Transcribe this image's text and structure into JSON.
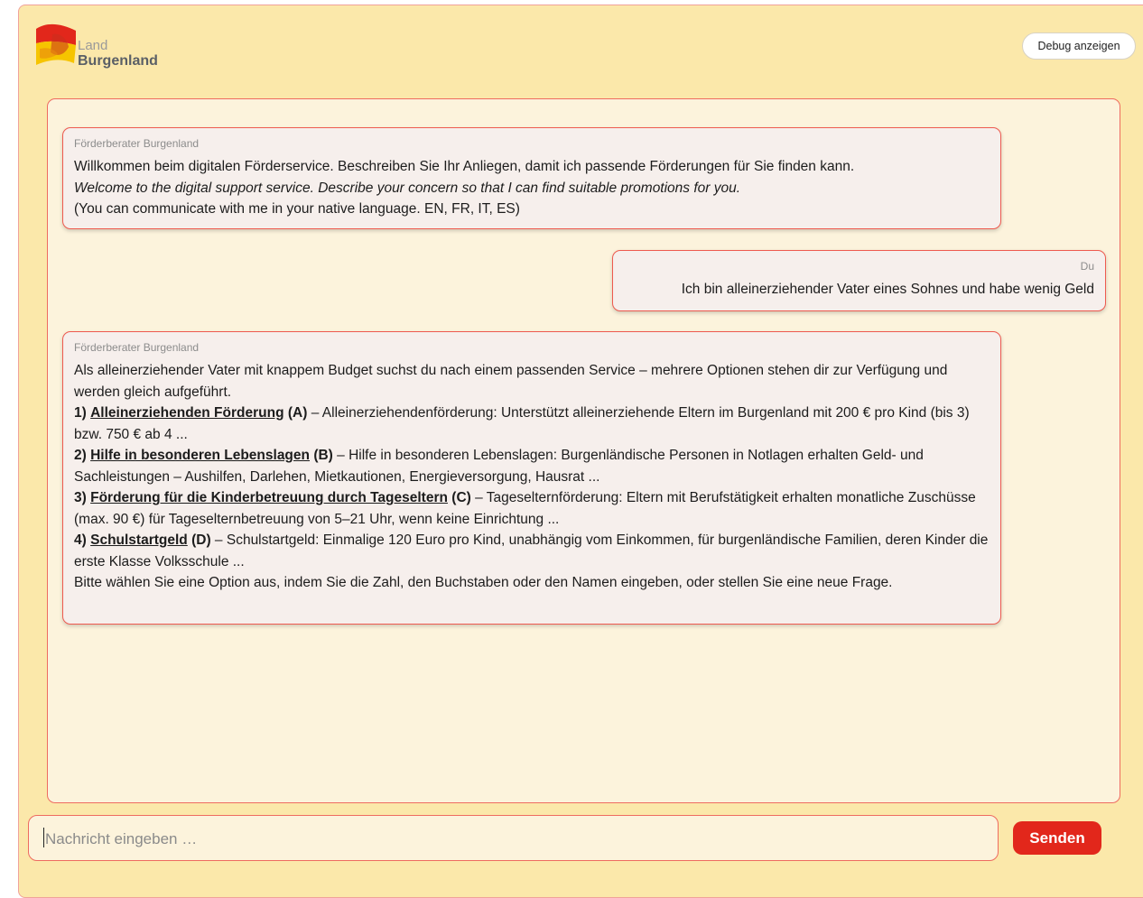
{
  "logo": {
    "line1": "Land",
    "line2": "Burgenland",
    "flag_colors": [
      "#e2271b",
      "#f6c400"
    ]
  },
  "header": {
    "debug_label": "Debug anzeigen"
  },
  "chat": {
    "messages": [
      {
        "sender": "Förderberater Burgenland",
        "line1": "Willkommen beim digitalen Förderservice. Beschreiben Sie Ihr Anliegen, damit ich passende Förderungen für Sie finden kann.",
        "line2": "Welcome to the digital support service. Describe your concern so that I can find suitable promotions for you.",
        "line3": "(You can communicate with me in your native language. EN, FR, IT, ES)"
      },
      {
        "sender": "Du",
        "text": "Ich bin alleinerziehender Vater eines Sohnes und habe wenig Geld"
      },
      {
        "sender": "Förderberater Burgenland",
        "intro": "Als alleinerziehender Vater mit knappem Budget suchst du nach einem passenden Service – mehrere Optionen stehen dir zur Verfügung und werden gleich aufgeführt.",
        "options": [
          {
            "num": "1)",
            "title": "Alleinerziehenden Förderung",
            "letter": "(A)",
            "desc": " – Alleinerziehendenförderung: Unterstützt alleinerziehende Eltern im Burgenland mit 200 € pro Kind (bis 3) bzw. 750 € ab 4 ..."
          },
          {
            "num": "2)",
            "title": "Hilfe in besonderen Lebenslagen",
            "letter": "(B)",
            "desc": " – Hilfe in besonderen Lebenslagen: Burgenländische Personen in Notlagen erhalten Geld- und Sachleistungen – Aushilfen, Darlehen, Mietkautionen, Energieversorgung, Hausrat ..."
          },
          {
            "num": "3)",
            "title": "Förderung für die Kinderbetreuung durch Tageseltern",
            "letter": "(C)",
            "desc": " – Tageselternförderung: Eltern mit Berufstätigkeit erhalten monatliche Zuschüsse (max. 90 €) für Tageselternbetreuung von 5–21 Uhr, wenn keine Einrichtung ..."
          },
          {
            "num": "4)",
            "title": "Schulstartgeld",
            "letter": "(D)",
            "desc": " – Schulstartgeld: Einmalige 120 Euro pro Kind, unabhängig vom Einkommen, für burgenländische Familien, deren Kinder die erste Klasse Volksschule ..."
          }
        ],
        "outro": "Bitte wählen Sie eine Option aus, indem Sie die Zahl, den Buchstaben oder den Namen eingeben, oder stellen Sie eine neue Frage."
      }
    ]
  },
  "composer": {
    "placeholder": "Nachricht eingeben …",
    "value": "",
    "send_label": "Senden"
  }
}
